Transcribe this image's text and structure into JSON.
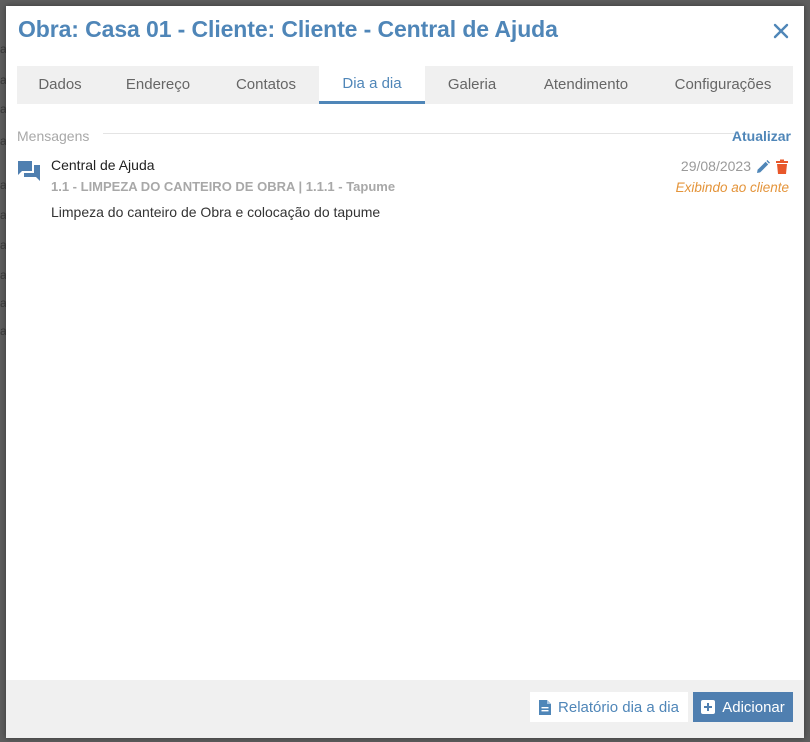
{
  "modal": {
    "title": "Obra: Casa 01 - Cliente: Cliente - Central de Ajuda",
    "close_icon": "close-icon"
  },
  "tabs": [
    {
      "label": "Dados",
      "active": false
    },
    {
      "label": "Endereço",
      "active": false
    },
    {
      "label": "Contatos",
      "active": false
    },
    {
      "label": "Dia a dia",
      "active": true
    },
    {
      "label": "Galeria",
      "active": false
    },
    {
      "label": "Atendimento",
      "active": false
    },
    {
      "label": "Configurações",
      "active": false
    }
  ],
  "messages_section": {
    "label": "Mensagens",
    "refresh_label": "Atualizar"
  },
  "messages": [
    {
      "icon": "chat-bubbles-icon",
      "author": "Central de Ajuda",
      "reference": "1.1 - LIMPEZA DO CANTEIRO DE OBRA | 1.1.1 - Tapume",
      "body": "Limpeza do canteiro de Obra e colocação do tapume",
      "date": "29/08/2023",
      "visibility": "Exibindo ao cliente"
    }
  ],
  "footer": {
    "report_label": "Relatório dia a dia",
    "add_label": "Adicionar"
  },
  "colors": {
    "accent": "#4f86b8",
    "active_tab_border": "#4f86b8",
    "visibility_text": "#e4943a",
    "delete_icon": "#e8572a",
    "tab_bar_bg": "#f0f0f0",
    "add_button_bg": "#4f7fb0"
  }
}
